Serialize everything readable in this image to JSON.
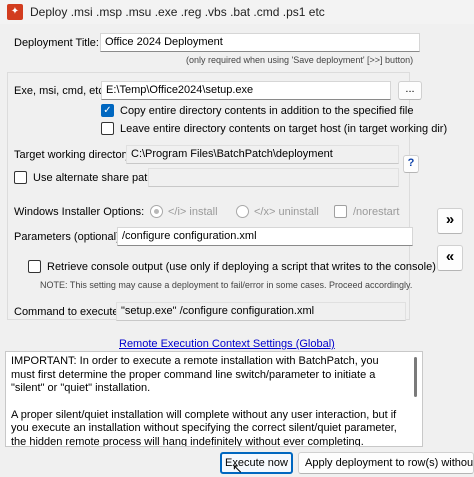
{
  "window": {
    "title": "Deploy .msi .msp .msu .exe .reg .vbs .bat .cmd .ps1 etc"
  },
  "deployment_title": {
    "label": "Deployment Title:",
    "value": "Office 2024 Deployment",
    "note": "(only required when using 'Save deployment' [>>] button)"
  },
  "file": {
    "label": "Exe, msi, cmd, etc:",
    "value": "E:\\Temp\\Office2024\\setup.exe",
    "browse_label": "...",
    "copy_dir_label": "Copy entire directory contents in addition to the specified file",
    "copy_dir_checked": true,
    "leave_dir_label": "Leave entire directory contents on target host (in target working dir)",
    "leave_dir_checked": false
  },
  "target_dir": {
    "label": "Target working directory:",
    "value": "C:\\Program Files\\BatchPatch\\deployment",
    "help_label": "?",
    "alt_share_label": "Use alternate share path:",
    "alt_share_checked": false,
    "alt_share_value": ""
  },
  "installer_options": {
    "label": "Windows Installer Options:",
    "install_label": "</i> install",
    "uninstall_label": "</x> uninstall",
    "norestart_label": "/norestart"
  },
  "parameters": {
    "label": "Parameters (optional):",
    "value": "/configure configuration.xml"
  },
  "console": {
    "label": "Retrieve console output (use only if deploying a script that writes to the console)",
    "checked": false,
    "note": "NOTE: This setting may cause a deployment to fail/error in some cases.  Proceed accordingly."
  },
  "command": {
    "label": "Command to execute:",
    "value": "\"setup.exe\" /configure configuration.xml"
  },
  "side_buttons": {
    "save_label": "»",
    "load_label": "«"
  },
  "remote_link": "Remote Execution Context Settings (Global)",
  "info": {
    "paragraph1": "IMPORTANT: In order to execute a remote installation with BatchPatch, you must first determine the proper command line switch/parameter to initiate a \"silent\" or \"quiet\" installation.",
    "paragraph2": "A proper silent/quiet installation will complete without any user interaction, but if you execute an installation without specifying the correct silent/quiet parameter, the hidden remote process will hang indefinitely without ever completing."
  },
  "footer": {
    "execute_label": "Execute now",
    "apply_label": "Apply deployment to row(s) without exe"
  }
}
